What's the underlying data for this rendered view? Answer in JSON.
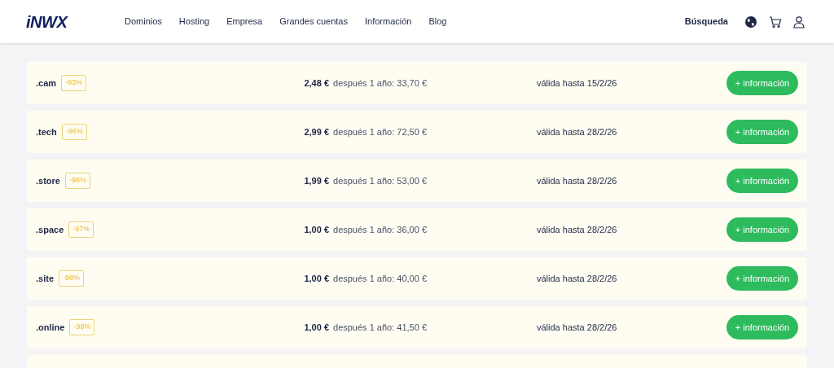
{
  "header": {
    "logo": "iNWX",
    "nav": [
      "Dominios",
      "Hosting",
      "Empresa",
      "Grandes cuentas",
      "Información",
      "Blog"
    ],
    "search": "Búsqueda"
  },
  "offers": [
    {
      "domain": ".cam",
      "discount": "-93%",
      "price": "2,48 €",
      "renewal": "después 1 año: 33,70 €",
      "valid": "válida hasta 15/2/26",
      "button": "+ información"
    },
    {
      "domain": ".tech",
      "discount": "-96%",
      "price": "2,99 €",
      "renewal": "después 1 año: 72,50 €",
      "valid": "válida hasta 28/2/26",
      "button": "+ información"
    },
    {
      "domain": ".store",
      "discount": "-96%",
      "price": "1,99 €",
      "renewal": "después 1 año: 53,00 €",
      "valid": "válida hasta 28/2/26",
      "button": "+ información"
    },
    {
      "domain": ".space",
      "discount": "-97%",
      "price": "1,00 €",
      "renewal": "después 1 año: 36,00 €",
      "valid": "válida hasta 28/2/26",
      "button": "+ información"
    },
    {
      "domain": ".site",
      "discount": "-98%",
      "price": "1,00 €",
      "renewal": "después 1 año: 40,00 €",
      "valid": "válida hasta 28/2/26",
      "button": "+ información"
    },
    {
      "domain": ".online",
      "discount": "-98%",
      "price": "1,00 €",
      "renewal": "después 1 año: 41,50 €",
      "valid": "válida hasta 28/2/26",
      "button": "+ información"
    }
  ]
}
